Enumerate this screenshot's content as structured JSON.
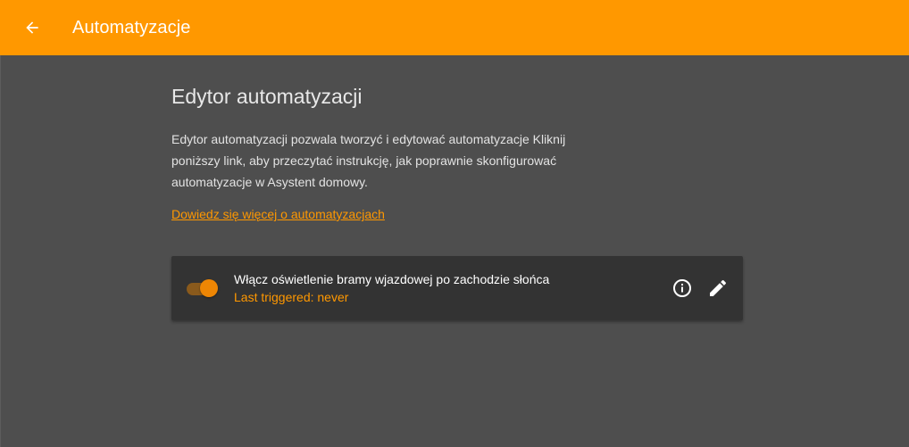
{
  "toolbar": {
    "title": "Automatyzacje",
    "back_icon": "arrow-left-icon",
    "background_color": "#ff9800"
  },
  "main": {
    "heading": "Edytor automatyzacji",
    "intro": "Edytor automatyzacji pozwala tworzyć i edytować automatyzacje Kliknij poniższy link, aby przeczytać instrukcję, jak poprawnie skonfigurować automatyzacje w Asystent domowy.",
    "learn_more": "Dowiedz się więcej o automatyzacjach"
  },
  "automations": [
    {
      "name": "Włącz oświetlenie bramy wjazdowej po zachodzie słońca",
      "status": "Last triggered: never",
      "enabled": true,
      "info_icon": "info-icon",
      "edit_icon": "pencil-icon"
    }
  ],
  "colors": {
    "accent": "#ff9800",
    "background": "#4e4e4e",
    "card": "#333333"
  }
}
